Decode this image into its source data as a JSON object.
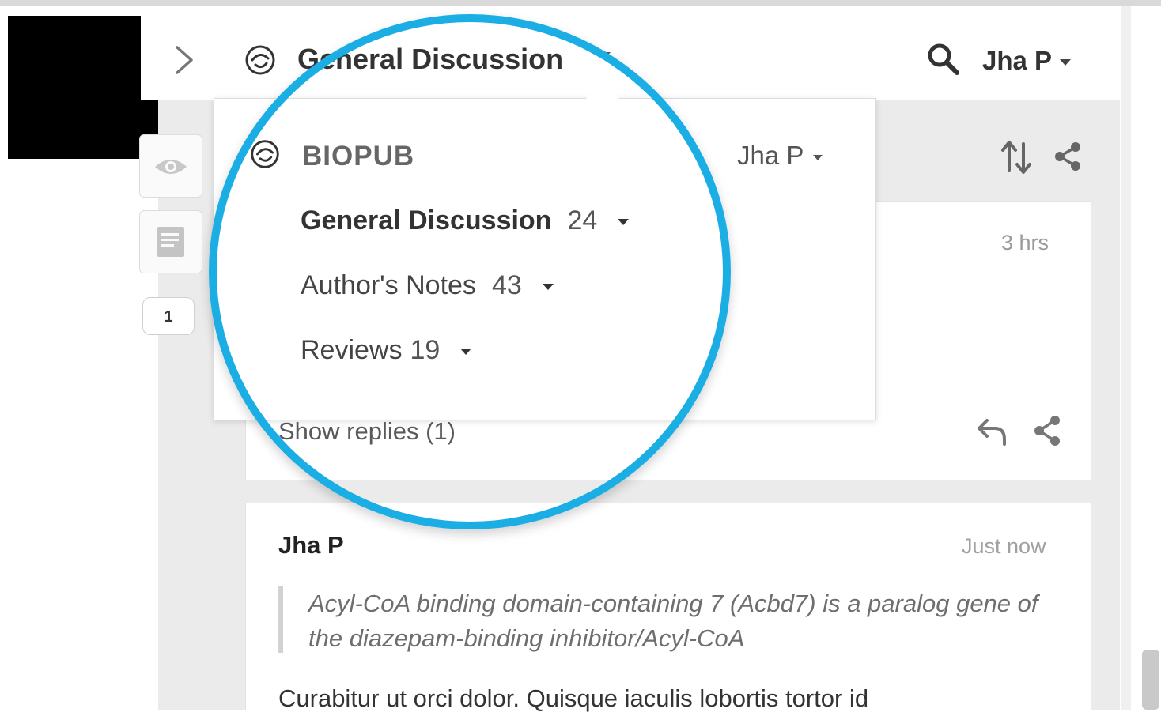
{
  "topbar": {
    "group_title": "General Discussion",
    "user_name": "Jha P"
  },
  "dropdown": {
    "group_name": "BIOPUB",
    "user_name": "Jha P",
    "items": [
      {
        "label": "General Discussion",
        "count": "24",
        "selected": true
      },
      {
        "label": "Author's Notes",
        "count": "43",
        "selected": false
      },
      {
        "label": "Reviews",
        "count": "19",
        "selected": false
      }
    ]
  },
  "sidebar": {
    "count_tab": "1"
  },
  "annotations": [
    {
      "time": "3 hrs",
      "show_replies": "Show replies (1)"
    },
    {
      "author": "Jha P",
      "time": "Just now",
      "quote": "Acyl-CoA binding domain-containing 7 (Acbd7) is a paralog gene of the diazepam-binding inhibitor/Acyl-CoA",
      "body": "Curabitur ut orci dolor. Quisque iaculis lobortis tortor id"
    }
  ],
  "icons": [
    "chevron-right-icon",
    "hypothesis-logo-icon",
    "search-icon",
    "eye-icon",
    "notes-icon",
    "sort-icon",
    "share-icon",
    "reply-icon"
  ],
  "colors": {
    "magnifier_ring": "#1aaee4",
    "panel_bg": "#ebebeb",
    "text": "#333333"
  }
}
